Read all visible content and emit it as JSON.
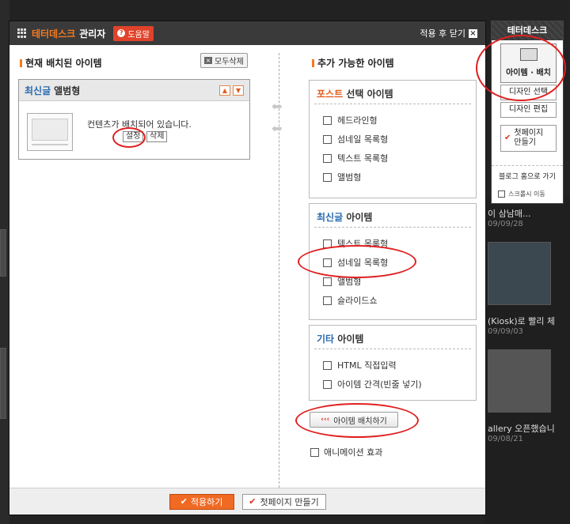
{
  "header": {
    "brand": "테터데스크",
    "admin": "관리자",
    "help": "도움말",
    "apply_close": "적용 후 닫기"
  },
  "left": {
    "title": "현재 배치된 아이템",
    "delete_all": "모두삭제",
    "placed": {
      "label_blue": "최신글",
      "label": "앨범형",
      "message": "컨텐츠가 배치되어 있습니다.",
      "settings": "설정",
      "delete": "삭제"
    }
  },
  "right": {
    "title": "추가 가능한 아이템",
    "groups": [
      {
        "title_colored": "포스트",
        "title": "선택 아이템",
        "color": "#e06020",
        "items": [
          "헤드라인형",
          "섬네일 목록형",
          "텍스트 목록형",
          "앨범형"
        ]
      },
      {
        "title_colored": "최신글",
        "title": "아이템",
        "color": "#2a6bb0",
        "items": [
          "텍스트 목록형",
          "섬네일 목록형",
          "앨범형",
          "슬라이드쇼"
        ]
      },
      {
        "title_colored": "기타",
        "title": "아이템",
        "color": "#2a6bb0",
        "items": [
          "HTML 직접입력",
          "아이템 간격(빈줄 넣기)"
        ]
      }
    ],
    "place_button": "아이템 배치하기",
    "animation": "애니메이션 효과"
  },
  "footer": {
    "apply": "적용하기",
    "make_first": "첫페이지 만들기"
  },
  "sidebar": {
    "title": "테터데스크",
    "main": "아이템 · 배치",
    "design_select": "디자인 선택",
    "design_edit": "디자인 편집",
    "first_page": [
      "첫페이지",
      "만들기"
    ],
    "blog_home": "블로그 홈으로 가기",
    "scroll_move": "스크롤시 이동"
  },
  "background": {
    "texts": [
      "이 삼남매...",
      "(Kiosk)로 빨리 체",
      "allery 오픈했습니"
    ],
    "dates": [
      "09/09/28",
      "09/09/03",
      "09/08/21"
    ]
  }
}
